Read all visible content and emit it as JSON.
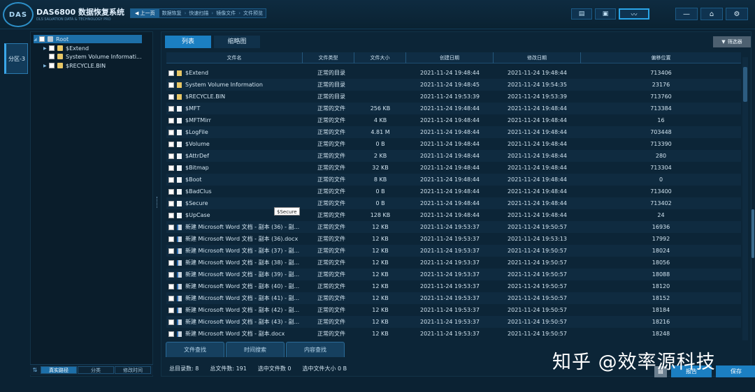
{
  "app": {
    "logo": "DAS",
    "title": "DAS6800 数据恢复系统",
    "subtitle": "DLS SALVATION DATA & TECHNOLOGY PRO"
  },
  "breadcrumb": {
    "back": "上一页",
    "items": [
      "数据恢复",
      "快速扫描",
      "镜像文件",
      "文件预览"
    ],
    "sep": "›"
  },
  "top_icons": [
    "list-icon",
    "briefcase-icon",
    "waveform-icon"
  ],
  "window_controls": [
    "minimize-icon",
    "home-icon",
    "gear-icon"
  ],
  "side_tab": "分区-3",
  "tree": {
    "root": "Root",
    "children": [
      "$Extend",
      "System Volume Informati...",
      "$RECYCLE.BIN"
    ]
  },
  "tree_footer": {
    "tabs": [
      "真实路径",
      "分类",
      "修改时间"
    ],
    "active": 0
  },
  "view_tabs": [
    "列表",
    "缩略图"
  ],
  "filter_label": "筛选器",
  "columns": [
    "文件名",
    "文件类型",
    "文件大小",
    "创建日期",
    "修改日期",
    "偏移位置"
  ],
  "rows": [
    {
      "icon": "folder",
      "name": "$Extend",
      "type": "正常的目录",
      "size": "",
      "ctime": "2021-11-24 19:48:44",
      "mtime": "2021-11-24 19:48:44",
      "offset": "713406"
    },
    {
      "icon": "folder",
      "name": "System Volume Information",
      "type": "正常的目录",
      "size": "",
      "ctime": "2021-11-24 19:48:45",
      "mtime": "2021-11-24 19:54:35",
      "offset": "23176"
    },
    {
      "icon": "folder",
      "name": "$RECYCLE.BIN",
      "type": "正常的目录",
      "size": "",
      "ctime": "2021-11-24 19:53:39",
      "mtime": "2021-11-24 19:53:39",
      "offset": "713760"
    },
    {
      "icon": "file",
      "name": "$MFT",
      "type": "正常的文件",
      "size": "256 KB",
      "ctime": "2021-11-24 19:48:44",
      "mtime": "2021-11-24 19:48:44",
      "offset": "713384"
    },
    {
      "icon": "file",
      "name": "$MFTMirr",
      "type": "正常的文件",
      "size": "4 KB",
      "ctime": "2021-11-24 19:48:44",
      "mtime": "2021-11-24 19:48:44",
      "offset": "16"
    },
    {
      "icon": "file",
      "name": "$LogFile",
      "type": "正常的文件",
      "size": "4.81 M",
      "ctime": "2021-11-24 19:48:44",
      "mtime": "2021-11-24 19:48:44",
      "offset": "703448"
    },
    {
      "icon": "file",
      "name": "$Volume",
      "type": "正常的文件",
      "size": "0 B",
      "ctime": "2021-11-24 19:48:44",
      "mtime": "2021-11-24 19:48:44",
      "offset": "713390"
    },
    {
      "icon": "file",
      "name": "$AttrDef",
      "type": "正常的文件",
      "size": "2 KB",
      "ctime": "2021-11-24 19:48:44",
      "mtime": "2021-11-24 19:48:44",
      "offset": "280"
    },
    {
      "icon": "file",
      "name": "$Bitmap",
      "type": "正常的文件",
      "size": "32 KB",
      "ctime": "2021-11-24 19:48:44",
      "mtime": "2021-11-24 19:48:44",
      "offset": "713304"
    },
    {
      "icon": "file",
      "name": "$Boot",
      "type": "正常的文件",
      "size": "8 KB",
      "ctime": "2021-11-24 19:48:44",
      "mtime": "2021-11-24 19:48:44",
      "offset": "0"
    },
    {
      "icon": "file",
      "name": "$BadClus",
      "type": "正常的文件",
      "size": "0 B",
      "ctime": "2021-11-24 19:48:44",
      "mtime": "2021-11-24 19:48:44",
      "offset": "713400"
    },
    {
      "icon": "file",
      "name": "$Secure",
      "type": "正常的文件",
      "size": "0 B",
      "ctime": "2021-11-24 19:48:44",
      "mtime": "2021-11-24 19:48:44",
      "offset": "713402"
    },
    {
      "icon": "file",
      "name": "$UpCase",
      "type": "正常的文件",
      "size": "128 KB",
      "ctime": "2021-11-24 19:48:44",
      "mtime": "2021-11-24 19:48:44",
      "offset": "24"
    },
    {
      "icon": "doc",
      "name": "新建 Microsoft Word 文档 - 副本 (36) - 副...",
      "type": "正常的文件",
      "size": "12 KB",
      "ctime": "2021-11-24 19:53:37",
      "mtime": "2021-11-24 19:50:57",
      "offset": "16936"
    },
    {
      "icon": "doc",
      "name": "新建 Microsoft Word 文档 - 副本 (36).docx",
      "type": "正常的文件",
      "size": "12 KB",
      "ctime": "2021-11-24 19:53:37",
      "mtime": "2021-11-24 19:53:13",
      "offset": "17992"
    },
    {
      "icon": "doc",
      "name": "新建 Microsoft Word 文档 - 副本 (37) - 副...",
      "type": "正常的文件",
      "size": "12 KB",
      "ctime": "2021-11-24 19:53:37",
      "mtime": "2021-11-24 19:50:57",
      "offset": "18024"
    },
    {
      "icon": "doc",
      "name": "新建 Microsoft Word 文档 - 副本 (38) - 副...",
      "type": "正常的文件",
      "size": "12 KB",
      "ctime": "2021-11-24 19:53:37",
      "mtime": "2021-11-24 19:50:57",
      "offset": "18056"
    },
    {
      "icon": "doc",
      "name": "新建 Microsoft Word 文档 - 副本 (39) - 副...",
      "type": "正常的文件",
      "size": "12 KB",
      "ctime": "2021-11-24 19:53:37",
      "mtime": "2021-11-24 19:50:57",
      "offset": "18088"
    },
    {
      "icon": "doc",
      "name": "新建 Microsoft Word 文档 - 副本 (40) - 副...",
      "type": "正常的文件",
      "size": "12 KB",
      "ctime": "2021-11-24 19:53:37",
      "mtime": "2021-11-24 19:50:57",
      "offset": "18120"
    },
    {
      "icon": "doc",
      "name": "新建 Microsoft Word 文档 - 副本 (41) - 副...",
      "type": "正常的文件",
      "size": "12 KB",
      "ctime": "2021-11-24 19:53:37",
      "mtime": "2021-11-24 19:50:57",
      "offset": "18152"
    },
    {
      "icon": "doc",
      "name": "新建 Microsoft Word 文档 - 副本 (42) - 副...",
      "type": "正常的文件",
      "size": "12 KB",
      "ctime": "2021-11-24 19:53:37",
      "mtime": "2021-11-24 19:50:57",
      "offset": "18184"
    },
    {
      "icon": "doc",
      "name": "新建 Microsoft Word 文档 - 副本 (43) - 副...",
      "type": "正常的文件",
      "size": "12 KB",
      "ctime": "2021-11-24 19:53:37",
      "mtime": "2021-11-24 19:50:57",
      "offset": "18216"
    },
    {
      "icon": "doc",
      "name": "新建 Microsoft Word 文档 - 副本.docx",
      "type": "正常的文件",
      "size": "12 KB",
      "ctime": "2021-11-24 19:53:37",
      "mtime": "2021-11-24 19:50:57",
      "offset": "18248"
    }
  ],
  "tooltip": "$Secure",
  "search_tabs": [
    "文件查找",
    "时间搜索",
    "内容查找"
  ],
  "status": {
    "dirs": "总目录数:  8",
    "files": "总文件数:  191",
    "sel_files": "选中文件数  0",
    "sel_size": "选中文件大小  0 B"
  },
  "buttons": {
    "report": "报告",
    "save": "保存"
  },
  "watermark": "知乎 @效率源科技",
  "colors": {
    "accent": "#1b7fc2",
    "background": "#0b2233",
    "folder": "#e8c766"
  }
}
